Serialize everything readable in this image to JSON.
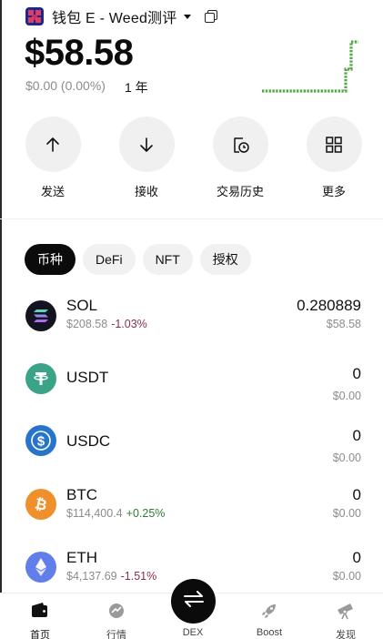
{
  "header": {
    "wallet_name": "钱包 E - Weed测评",
    "balance": "$58.58",
    "pnl": "$0.00 (0.00%)",
    "period": "1 年"
  },
  "actions": [
    {
      "label": "发送",
      "icon": "arrow-up-icon"
    },
    {
      "label": "接收",
      "icon": "arrow-down-icon"
    },
    {
      "label": "交易历史",
      "icon": "history-icon"
    },
    {
      "label": "更多",
      "icon": "grid-icon"
    }
  ],
  "chips": [
    {
      "label": "币种",
      "active": true
    },
    {
      "label": "DeFi",
      "active": false
    },
    {
      "label": "NFT",
      "active": false
    },
    {
      "label": "授权",
      "active": false
    }
  ],
  "assets": [
    {
      "symbol": "SOL",
      "price": "$208.58",
      "change": "-1.03%",
      "change_color": "#8a2e4a",
      "amount": "0.280889",
      "value": "$58.58"
    },
    {
      "symbol": "USDT",
      "price": "",
      "change": "",
      "change_color": "#8c8c8c",
      "amount": "0",
      "value": "$0.00"
    },
    {
      "symbol": "USDC",
      "price": "",
      "change": "",
      "change_color": "#8c8c8c",
      "amount": "0",
      "value": "$0.00"
    },
    {
      "symbol": "BTC",
      "price": "$114,400.4",
      "change": "+0.25%",
      "change_color": "#2e7d32",
      "amount": "0",
      "value": "$0.00"
    },
    {
      "symbol": "ETH",
      "price": "$4,137.69",
      "change": "-1.51%",
      "change_color": "#8a2e4a",
      "amount": "0",
      "value": "$0.00"
    }
  ],
  "tabbar": [
    {
      "label": "首页",
      "icon": "wallet-icon",
      "active": true
    },
    {
      "label": "行情",
      "icon": "market-icon",
      "active": false
    },
    {
      "label": "DEX",
      "icon": "swap-icon",
      "active": false
    },
    {
      "label": "Boost",
      "icon": "rocket-icon",
      "active": false
    },
    {
      "label": "发现",
      "icon": "telescope-icon",
      "active": false
    }
  ],
  "colors": {
    "sparkline": "#55a84a",
    "negative": "#8a2e4a",
    "positive": "#2e7d32"
  }
}
